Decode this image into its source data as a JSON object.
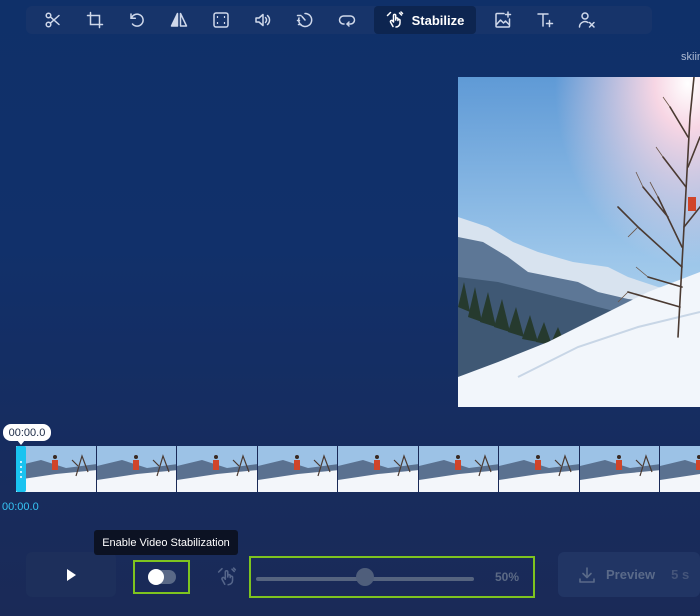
{
  "toolbar": {
    "tools": [
      {
        "name": "cut",
        "icon": "scissors-icon"
      },
      {
        "name": "crop",
        "icon": "crop-icon"
      },
      {
        "name": "rotate",
        "icon": "rotate-icon"
      },
      {
        "name": "flip",
        "icon": "flip-icon"
      },
      {
        "name": "resize",
        "icon": "resize-frame-icon"
      },
      {
        "name": "volume",
        "icon": "volume-icon"
      },
      {
        "name": "speed",
        "icon": "speed-icon"
      },
      {
        "name": "loop",
        "icon": "loop-icon"
      },
      {
        "name": "stabilize",
        "icon": "stabilize-hand-icon",
        "label": "Stabilize",
        "active": true
      },
      {
        "name": "add-image",
        "icon": "add-image-icon"
      },
      {
        "name": "add-text",
        "icon": "add-text-icon"
      },
      {
        "name": "remove-person",
        "icon": "remove-person-icon"
      }
    ]
  },
  "video": {
    "filename": "skiing",
    "current_time": "00:00.0",
    "start_time": "00:00.0",
    "frame_count": 9
  },
  "controls": {
    "tooltip": "Enable Video Stabilization",
    "stabilization_enabled": false,
    "strength_percent": 50,
    "strength_label": "50%",
    "preview_label": "Preview",
    "preview_duration": "5 s"
  },
  "colors": {
    "accent": "#19c3f0",
    "highlight_border": "#7ec41f",
    "sky": "#82b6e2",
    "snow": "#f2f6fb"
  }
}
